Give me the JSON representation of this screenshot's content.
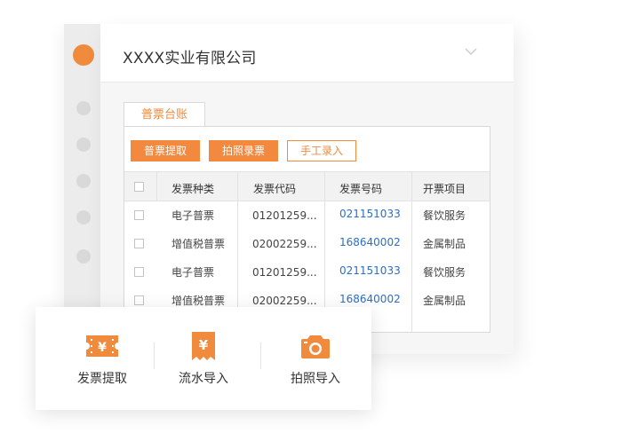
{
  "company_name": "XXXX实业有限公司",
  "tab": {
    "label": "普票台账"
  },
  "toolbar": {
    "extract_label": "普票提取",
    "photo_entry_label": "拍照录票",
    "manual_entry_label": "手工录入"
  },
  "table": {
    "columns": [
      "发票种类",
      "发票代码",
      "发票号码",
      "开票项目"
    ],
    "rows": [
      {
        "type": "电子普票",
        "code": "01201259...",
        "number": "021151033",
        "item": "餐饮服务"
      },
      {
        "type": "增值税普票",
        "code": "02002259...",
        "number": "168640002",
        "item": "金属制品"
      },
      {
        "type": "电子普票",
        "code": "01201259...",
        "number": "021151033",
        "item": "餐饮服务"
      },
      {
        "type": "增值税普票",
        "code": "02002259...",
        "number": "168640002",
        "item": "金属制品"
      }
    ]
  },
  "popup": {
    "items": [
      {
        "label": "发票提取",
        "icon": "invoice-ticket-icon"
      },
      {
        "label": "流水导入",
        "icon": "receipt-yuan-icon"
      },
      {
        "label": "拍照导入",
        "icon": "camera-icon"
      }
    ]
  },
  "colors": {
    "accent": "#f08a3c",
    "link": "#2a6fc4"
  }
}
